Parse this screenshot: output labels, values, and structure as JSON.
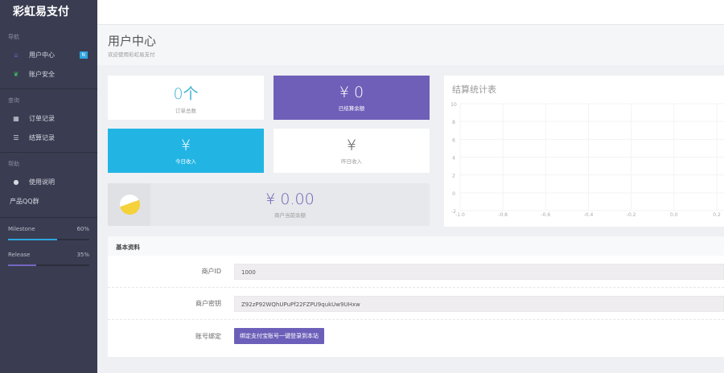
{
  "sidebar": {
    "brand": "彩虹易支付",
    "sections": [
      {
        "title": "导航",
        "items": [
          {
            "label": "用户中心",
            "badge": "N"
          },
          {
            "label": "账户安全"
          }
        ]
      },
      {
        "title": "查询",
        "items": [
          {
            "label": "订单记录"
          },
          {
            "label": "结算记录"
          }
        ]
      },
      {
        "title": "帮助",
        "items": [
          {
            "label": "使用说明"
          },
          {
            "label": "产品QQ群"
          }
        ]
      }
    ],
    "progress": [
      {
        "label": "Milestone",
        "value": "60%",
        "fraction": 0.6,
        "color": "#2fa5e0"
      },
      {
        "label": "Release",
        "value": "35%",
        "fraction": 0.35,
        "color": "#7266c0"
      }
    ]
  },
  "header": {
    "title": "用户中心",
    "subtitle": "欢迎使用彩虹易支付"
  },
  "stats": {
    "orders": {
      "value": "0个",
      "label": "订单总数"
    },
    "settled": {
      "value": "¥ 0",
      "label": "已结算余额"
    },
    "today": {
      "value": "¥",
      "label": "今日收入"
    },
    "yesterday": {
      "value": "¥",
      "label": "昨日收入"
    },
    "balance": {
      "value": "¥ 0.00",
      "label": "商户当前余额"
    }
  },
  "colors": {
    "purple": "#6f5fb8",
    "cyan": "#22b5e4",
    "yellow": "#f5d13a"
  },
  "chart_data": {
    "type": "line",
    "title": "结算统计表",
    "series": [],
    "xlim": [
      -1.0,
      0.2
    ],
    "ylim": [
      -2,
      10
    ],
    "xticks": [
      "-1.0",
      "-0.8",
      "-0.6",
      "-0.4",
      "-0.2",
      "0.0",
      "0.2"
    ],
    "yticks": [
      "10",
      "8",
      "6",
      "4",
      "2",
      "0",
      "-2"
    ],
    "grid": true
  },
  "info": {
    "title": "基本资料",
    "fields": [
      {
        "label": "商户ID",
        "value": "1000"
      },
      {
        "label": "商户密钥",
        "value": "Z92zP92WQhUPuPf22FZPU9qukUw9UHxw"
      }
    ],
    "bind_label": "账号绑定",
    "bind_button": "绑定支付宝账号一键登录到本站"
  }
}
